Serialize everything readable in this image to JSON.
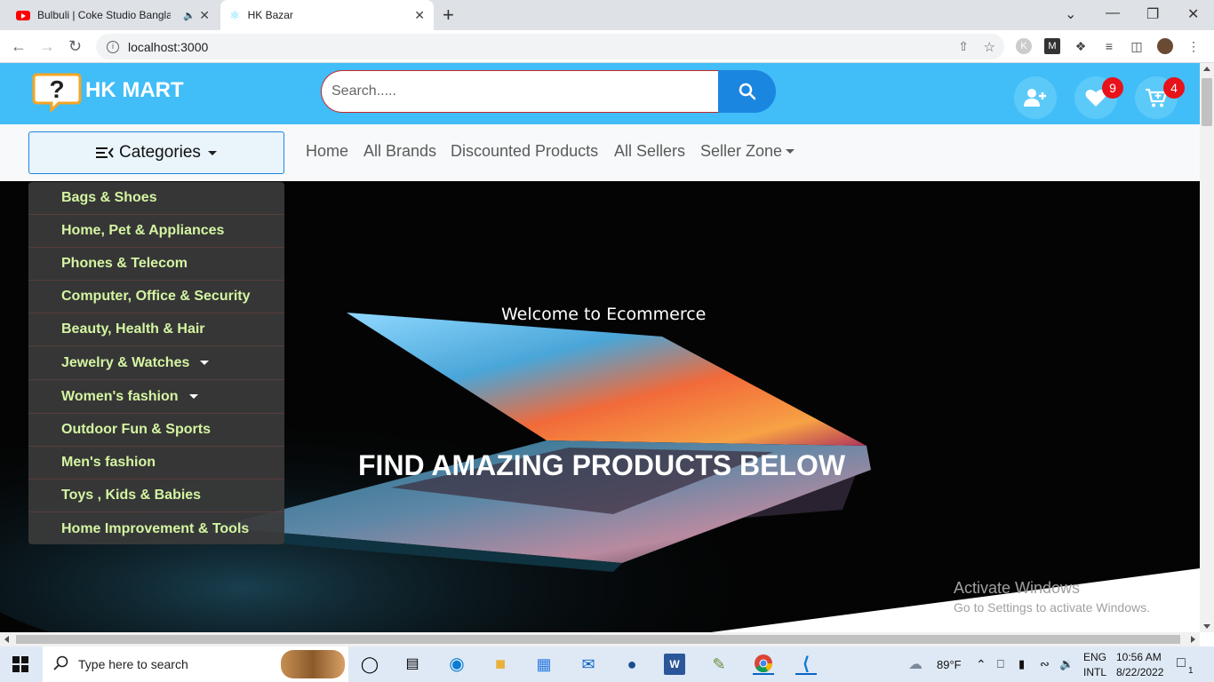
{
  "browser": {
    "tabs": [
      {
        "title": "Bulbuli | Coke Studio Bangla"
      },
      {
        "title": "HK Bazar"
      }
    ],
    "url": "localhost:3000"
  },
  "site": {
    "brand": "HK MART",
    "logo_glyph": "?",
    "search_placeholder": "Search.....",
    "wishlist_count": "9",
    "cart_count": "4",
    "colors": {
      "header": "#41bdf8",
      "search_button": "#1b86e0",
      "badge": "#e8121a",
      "category_text": "#d4f5a2"
    }
  },
  "nav": {
    "categories_label": "Categories",
    "links": [
      {
        "label": "Home"
      },
      {
        "label": "All Brands"
      },
      {
        "label": "Discounted Products"
      },
      {
        "label": "All Sellers"
      },
      {
        "label": "Seller Zone"
      }
    ]
  },
  "categories": [
    {
      "label": "Bags & Shoes"
    },
    {
      "label": "Home, Pet & Appliances"
    },
    {
      "label": "Phones & Telecom"
    },
    {
      "label": "Computer, Office & Security"
    },
    {
      "label": "Beauty, Health & Hair"
    },
    {
      "label": "Jewelry & Watches"
    },
    {
      "label": "Women's fashion"
    },
    {
      "label": "Outdoor Fun & Sports"
    },
    {
      "label": "Men's fashion"
    },
    {
      "label": "Toys , Kids & Babies"
    },
    {
      "label": "Home Improvement & Tools"
    }
  ],
  "hero": {
    "welcome": "Welcome to Ecommerce",
    "headline": "FIND AMAZING PRODUCTS BELOW"
  },
  "watermark": {
    "line1": "Activate Windows",
    "line2": "Go to Settings to activate Windows."
  },
  "taskbar": {
    "search_placeholder": "Type here to search",
    "weather": "89°F",
    "lang1": "ENG",
    "lang2": "INTL",
    "time": "10:56 AM",
    "date": "8/22/2022",
    "notification_count": "1"
  }
}
